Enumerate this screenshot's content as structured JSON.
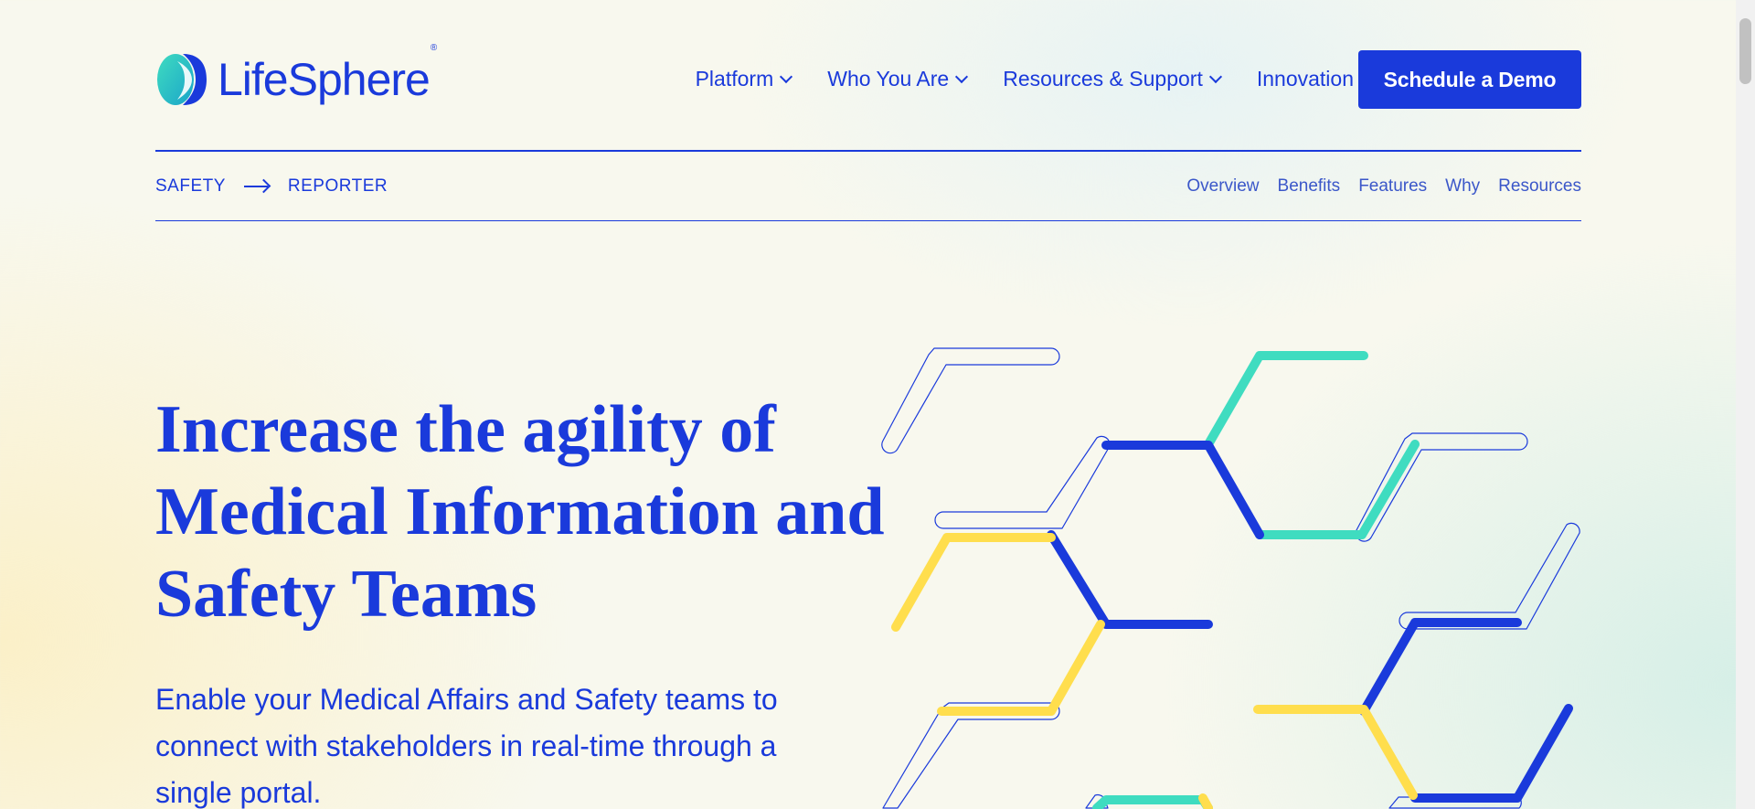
{
  "brand": {
    "name": "LifeSphere",
    "registered": "®"
  },
  "nav": {
    "items": [
      {
        "label": "Platform"
      },
      {
        "label": "Who You Are"
      },
      {
        "label": "Resources & Support"
      },
      {
        "label": "Innovation"
      }
    ],
    "cta_label": "Schedule a Demo"
  },
  "breadcrumb": {
    "items": [
      "SAFETY",
      "REPORTER"
    ]
  },
  "subnav": {
    "items": [
      "Overview",
      "Benefits",
      "Features",
      "Why",
      "Resources"
    ]
  },
  "hero": {
    "title_lines": [
      "Increase the agility of",
      "Medical Information and",
      "Safety Teams"
    ],
    "subtitle_lines": [
      "Enable your Medical Affairs and Safety teams to",
      "connect with stakeholders in real-time through a",
      "single portal."
    ]
  },
  "colors": {
    "brand_blue": "#1a3adb",
    "teal": "#3fdcc0",
    "yellow": "#ffde4d"
  }
}
